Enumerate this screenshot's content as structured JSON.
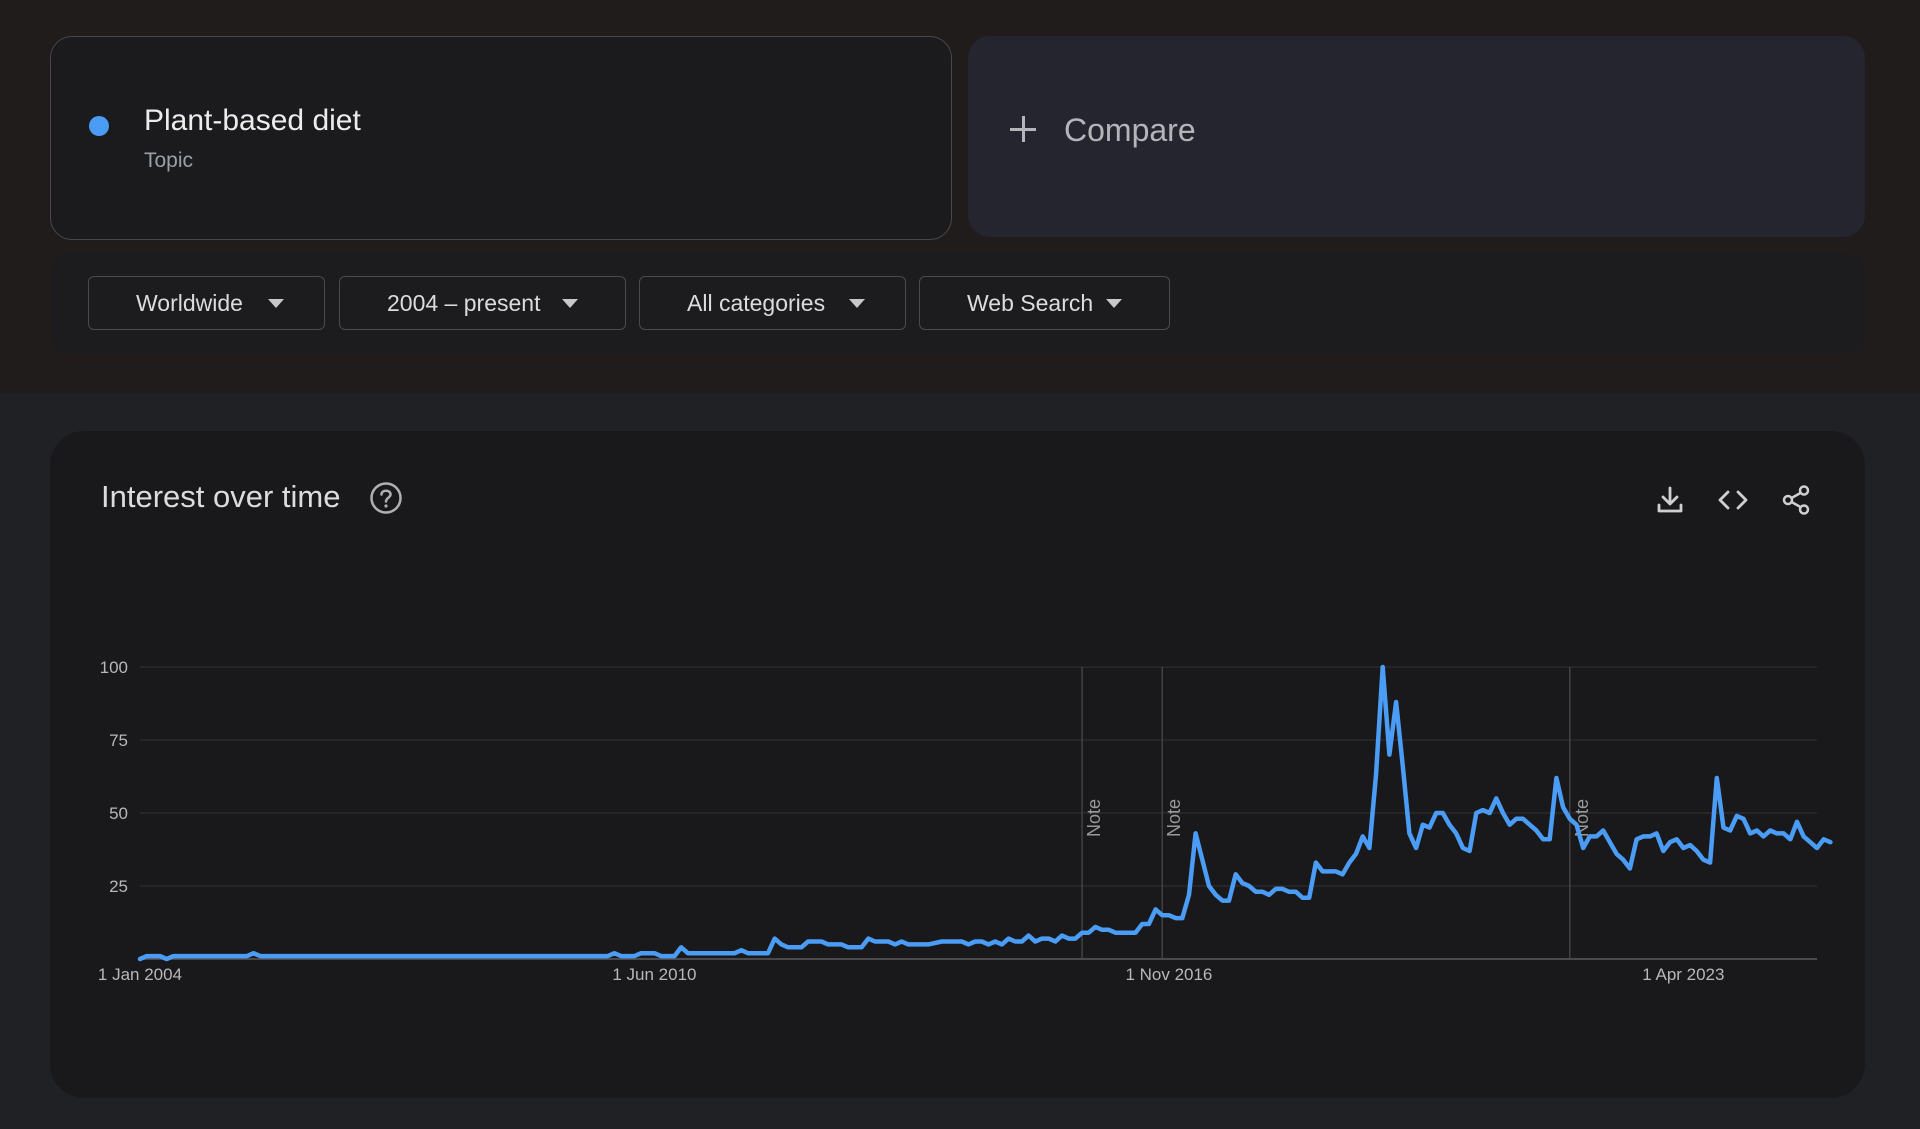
{
  "search_term": {
    "name": "Plant-based diet",
    "type": "Topic",
    "color": "#4a9cf5"
  },
  "compare": {
    "label": "Compare"
  },
  "filters": {
    "region": "Worldwide",
    "time_range": "2004 – present",
    "category": "All categories",
    "search_type": "Web Search"
  },
  "chart_panel": {
    "title": "Interest over time",
    "icons": [
      "help-icon",
      "download-icon",
      "embed-code-icon",
      "share-icon"
    ]
  },
  "chart_data": {
    "type": "line",
    "title": "Interest over time",
    "x_start": "2004-01",
    "x_end": "2024-12",
    "x_tick_labels": [
      {
        "label": "1 Jan 2004",
        "date": "2004-01"
      },
      {
        "label": "1 Jun 2010",
        "date": "2010-06"
      },
      {
        "label": "1 Nov 2016",
        "date": "2016-11"
      },
      {
        "label": "1 Apr 2023",
        "date": "2023-04"
      }
    ],
    "y_ticks": [
      25,
      50,
      75,
      100
    ],
    "ylim": [
      0,
      100
    ],
    "grid": true,
    "notes": [
      {
        "label": "Note",
        "date": "2015-10"
      },
      {
        "label": "Note",
        "date": "2016-10"
      },
      {
        "label": "Note",
        "date": "2021-11"
      }
    ],
    "series": [
      {
        "color": "#4a9cf5",
        "points": [
          [
            "2004-01",
            0
          ],
          [
            "2004-02",
            1
          ],
          [
            "2004-04",
            1
          ],
          [
            "2004-05",
            0
          ],
          [
            "2004-06",
            1
          ],
          [
            "2005-01",
            1
          ],
          [
            "2005-05",
            1
          ],
          [
            "2005-06",
            2
          ],
          [
            "2005-07",
            1
          ],
          [
            "2006-06",
            1
          ],
          [
            "2007-06",
            1
          ],
          [
            "2008-06",
            1
          ],
          [
            "2009-06",
            1
          ],
          [
            "2009-11",
            1
          ],
          [
            "2009-12",
            2
          ],
          [
            "2010-01",
            1
          ],
          [
            "2010-03",
            1
          ],
          [
            "2010-04",
            2
          ],
          [
            "2010-06",
            2
          ],
          [
            "2010-07",
            1
          ],
          [
            "2010-09",
            1
          ],
          [
            "2010-10",
            4
          ],
          [
            "2010-11",
            2
          ],
          [
            "2011-06",
            2
          ],
          [
            "2011-07",
            3
          ],
          [
            "2011-08",
            2
          ],
          [
            "2011-11",
            2
          ],
          [
            "2011-12",
            7
          ],
          [
            "2012-01",
            5
          ],
          [
            "2012-02",
            4
          ],
          [
            "2012-04",
            4
          ],
          [
            "2012-05",
            6
          ],
          [
            "2012-07",
            6
          ],
          [
            "2012-08",
            5
          ],
          [
            "2012-10",
            5
          ],
          [
            "2012-11",
            4
          ],
          [
            "2013-01",
            4
          ],
          [
            "2013-02",
            7
          ],
          [
            "2013-03",
            6
          ],
          [
            "2013-05",
            6
          ],
          [
            "2013-06",
            5
          ],
          [
            "2013-07",
            6
          ],
          [
            "2013-08",
            5
          ],
          [
            "2013-11",
            5
          ],
          [
            "2014-01",
            6
          ],
          [
            "2014-04",
            6
          ],
          [
            "2014-05",
            5
          ],
          [
            "2014-06",
            6
          ],
          [
            "2014-07",
            6
          ],
          [
            "2014-08",
            5
          ],
          [
            "2014-09",
            6
          ],
          [
            "2014-10",
            5
          ],
          [
            "2014-11",
            7
          ],
          [
            "2014-12",
            6
          ],
          [
            "2015-01",
            6
          ],
          [
            "2015-02",
            8
          ],
          [
            "2015-03",
            6
          ],
          [
            "2015-04",
            7
          ],
          [
            "2015-05",
            7
          ],
          [
            "2015-06",
            6
          ],
          [
            "2015-07",
            8
          ],
          [
            "2015-08",
            7
          ],
          [
            "2015-09",
            7
          ],
          [
            "2015-10",
            9
          ],
          [
            "2015-11",
            9
          ],
          [
            "2015-12",
            11
          ],
          [
            "2016-01",
            10
          ],
          [
            "2016-02",
            10
          ],
          [
            "2016-03",
            9
          ],
          [
            "2016-05",
            9
          ],
          [
            "2016-06",
            9
          ],
          [
            "2016-07",
            12
          ],
          [
            "2016-08",
            12
          ],
          [
            "2016-09",
            17
          ],
          [
            "2016-10",
            15
          ],
          [
            "2016-11",
            15
          ],
          [
            "2016-12",
            14
          ],
          [
            "2017-01",
            14
          ],
          [
            "2017-02",
            22
          ],
          [
            "2017-03",
            43
          ],
          [
            "2017-04",
            34
          ],
          [
            "2017-05",
            25
          ],
          [
            "2017-06",
            22
          ],
          [
            "2017-07",
            20
          ],
          [
            "2017-08",
            20
          ],
          [
            "2017-09",
            29
          ],
          [
            "2017-10",
            26
          ],
          [
            "2017-11",
            25
          ],
          [
            "2017-12",
            23
          ],
          [
            "2018-01",
            23
          ],
          [
            "2018-02",
            22
          ],
          [
            "2018-03",
            24
          ],
          [
            "2018-04",
            24
          ],
          [
            "2018-05",
            23
          ],
          [
            "2018-06",
            23
          ],
          [
            "2018-07",
            21
          ],
          [
            "2018-08",
            21
          ],
          [
            "2018-09",
            33
          ],
          [
            "2018-10",
            30
          ],
          [
            "2018-11",
            30
          ],
          [
            "2018-12",
            30
          ],
          [
            "2019-01",
            29
          ],
          [
            "2019-02",
            33
          ],
          [
            "2019-03",
            36
          ],
          [
            "2019-04",
            42
          ],
          [
            "2019-05",
            38
          ],
          [
            "2019-06",
            63
          ],
          [
            "2019-07",
            100
          ],
          [
            "2019-08",
            70
          ],
          [
            "2019-09",
            88
          ],
          [
            "2019-10",
            66
          ],
          [
            "2019-11",
            43
          ],
          [
            "2019-12",
            38
          ],
          [
            "2020-01",
            46
          ],
          [
            "2020-02",
            45
          ],
          [
            "2020-03",
            50
          ],
          [
            "2020-04",
            50
          ],
          [
            "2020-05",
            46
          ],
          [
            "2020-06",
            43
          ],
          [
            "2020-07",
            38
          ],
          [
            "2020-08",
            37
          ],
          [
            "2020-09",
            50
          ],
          [
            "2020-10",
            51
          ],
          [
            "2020-11",
            50
          ],
          [
            "2020-12",
            55
          ],
          [
            "2021-01",
            50
          ],
          [
            "2021-02",
            46
          ],
          [
            "2021-03",
            48
          ],
          [
            "2021-04",
            48
          ],
          [
            "2021-05",
            46
          ],
          [
            "2021-06",
            44
          ],
          [
            "2021-07",
            41
          ],
          [
            "2021-08",
            41
          ],
          [
            "2021-09",
            62
          ],
          [
            "2021-10",
            52
          ],
          [
            "2021-11",
            48
          ],
          [
            "2021-12",
            46
          ],
          [
            "2022-01",
            38
          ],
          [
            "2022-02",
            42
          ],
          [
            "2022-03",
            42
          ],
          [
            "2022-04",
            44
          ],
          [
            "2022-05",
            40
          ],
          [
            "2022-06",
            36
          ],
          [
            "2022-07",
            34
          ],
          [
            "2022-08",
            31
          ],
          [
            "2022-09",
            41
          ],
          [
            "2022-10",
            42
          ],
          [
            "2022-11",
            42
          ],
          [
            "2022-12",
            43
          ],
          [
            "2023-01",
            37
          ],
          [
            "2023-02",
            40
          ],
          [
            "2023-03",
            41
          ],
          [
            "2023-04",
            38
          ],
          [
            "2023-05",
            39
          ],
          [
            "2023-06",
            37
          ],
          [
            "2023-07",
            34
          ],
          [
            "2023-08",
            33
          ],
          [
            "2023-09",
            62
          ],
          [
            "2023-10",
            45
          ],
          [
            "2023-11",
            44
          ],
          [
            "2023-12",
            49
          ],
          [
            "2024-01",
            48
          ],
          [
            "2024-02",
            43
          ],
          [
            "2024-03",
            44
          ],
          [
            "2024-04",
            42
          ],
          [
            "2024-05",
            44
          ],
          [
            "2024-06",
            43
          ],
          [
            "2024-07",
            43
          ],
          [
            "2024-08",
            41
          ],
          [
            "2024-09",
            47
          ],
          [
            "2024-10",
            42
          ],
          [
            "2024-11",
            40
          ],
          [
            "2024-12",
            38
          ],
          [
            "2025-01",
            41
          ],
          [
            "2025-02",
            40
          ]
        ]
      }
    ]
  }
}
